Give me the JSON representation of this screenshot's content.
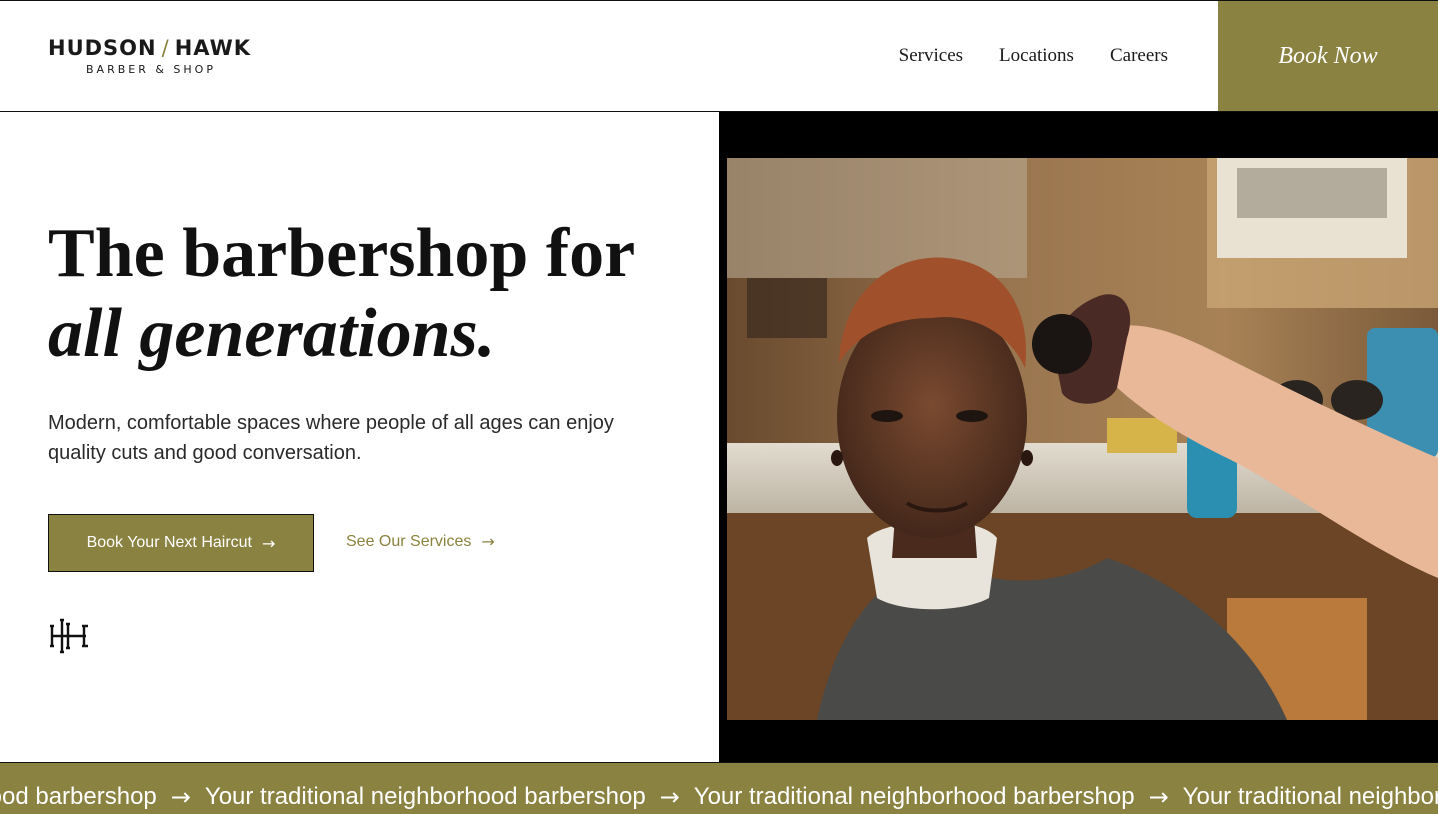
{
  "header": {
    "logo": {
      "name_left": "HUDSON",
      "slash": "/",
      "name_right": "HAWK",
      "tagline": "BARBER & SHOP"
    },
    "nav": [
      "Services",
      "Locations",
      "Careers"
    ],
    "book_now": "Book Now"
  },
  "hero": {
    "headline_line1": "The barbershop for",
    "headline_line2": "all generations.",
    "subtext": "Modern, comfortable spaces where people of all ages can enjoy quality cuts and good conversation.",
    "primary_cta": "Book Your Next Haircut",
    "secondary_cta": "See Our Services",
    "arrow": "→"
  },
  "marquee": {
    "text": "Your traditional neighborhood barbershop",
    "arrow": "→"
  },
  "colors": {
    "accent": "#8a8240",
    "text": "#111111",
    "background": "#ffffff"
  },
  "icons": [
    "arrow-right-icon",
    "hh-monogram-icon"
  ]
}
